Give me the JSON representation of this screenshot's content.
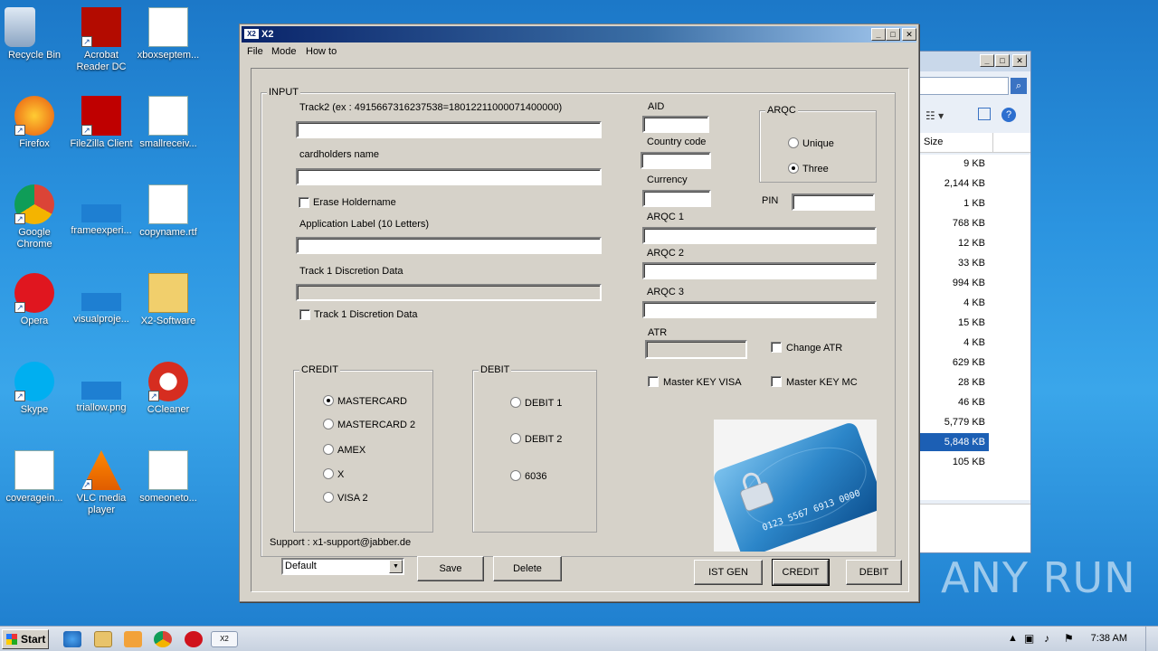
{
  "desktop": {
    "icons": [
      {
        "label": "Recycle Bin",
        "icon": "recycle-bin-icon"
      },
      {
        "label": "Acrobat Reader DC",
        "icon": "acrobat-icon"
      },
      {
        "label": "xboxseptem...",
        "icon": "word-doc-icon"
      },
      {
        "label": "Firefox",
        "icon": "firefox-icon"
      },
      {
        "label": "FileZilla Client",
        "icon": "filezilla-icon"
      },
      {
        "label": "smallreceiv...",
        "icon": "word-doc-icon"
      },
      {
        "label": "Google Chrome",
        "icon": "chrome-icon"
      },
      {
        "label": "frameexperi...",
        "icon": "image-file-icon"
      },
      {
        "label": "copyname.rtf",
        "icon": "word-doc-icon"
      },
      {
        "label": "Opera",
        "icon": "opera-icon"
      },
      {
        "label": "visualproje...",
        "icon": "image-file-icon"
      },
      {
        "label": "X2-Software",
        "icon": "folder-icon"
      },
      {
        "label": "Skype",
        "icon": "skype-icon"
      },
      {
        "label": "triallow.png",
        "icon": "image-file-icon"
      },
      {
        "label": "CCleaner",
        "icon": "ccleaner-icon"
      },
      {
        "label": "coveragein...",
        "icon": "word-doc-icon"
      },
      {
        "label": "VLC media player",
        "icon": "vlc-icon"
      },
      {
        "label": "someoneto...",
        "icon": "word-doc-icon"
      }
    ]
  },
  "explorer": {
    "size_header": "Size",
    "sizes": [
      "9 KB",
      "2,144 KB",
      "1 KB",
      "768 KB",
      "12 KB",
      "33 KB",
      "994 KB",
      "4 KB",
      "15 KB",
      "4 KB",
      "629 KB",
      "28 KB",
      "46 KB",
      "5,779 KB",
      "5,848 KB",
      "105 KB"
    ],
    "selected_index": 14
  },
  "window": {
    "title": "X2",
    "icon_text": "X2",
    "menu": [
      "File",
      "Mode",
      "How to"
    ]
  },
  "input": {
    "group_title": "INPUT",
    "track2_label": "Track2 (ex : 4915667316237538=18012211000071400000)",
    "cardholder_label": "cardholders name",
    "erase_holdername": "Erase Holdername",
    "app_label": "Application Label (10 Letters)",
    "track1_label": "Track 1 Discretion Data",
    "track1_check": "Track 1 Discretion Data",
    "aid_label": "AID",
    "country_label": "Country code",
    "currency_label": "Currency",
    "pin_label": "PIN",
    "arqc_group": "ARQC",
    "arqc_unique": "Unique",
    "arqc_three": "Three",
    "arqc1": "ARQC 1",
    "arqc2": "ARQC 2",
    "arqc3": "ARQC 3",
    "atr_label": "ATR",
    "change_atr": "Change ATR",
    "master_key_visa": "Master KEY VISA",
    "master_key_mc": "Master KEY MC",
    "credit_group": "CREDIT",
    "credit_options": [
      "MASTERCARD",
      "MASTERCARD 2",
      "AMEX",
      "X",
      "VISA 2"
    ],
    "debit_group": "DEBIT",
    "debit_options": [
      "DEBIT 1",
      "DEBIT 2",
      "6036"
    ],
    "support": "Support : x1-support@jabber.de"
  },
  "bottom": {
    "profile_value": "Default",
    "save": "Save",
    "delete": "Delete",
    "ist_gen": "IST GEN",
    "credit": "CREDIT",
    "debit": "DEBIT"
  },
  "card": {
    "number_text": "0123 5567 6913 0000"
  },
  "taskbar": {
    "start": "Start",
    "clock": "7:38 AM",
    "apps": [
      "ie-icon",
      "explorer-icon",
      "media-player-icon",
      "chrome-icon",
      "opera-icon",
      "x2-app-icon"
    ]
  },
  "watermark": "ANY RUN"
}
